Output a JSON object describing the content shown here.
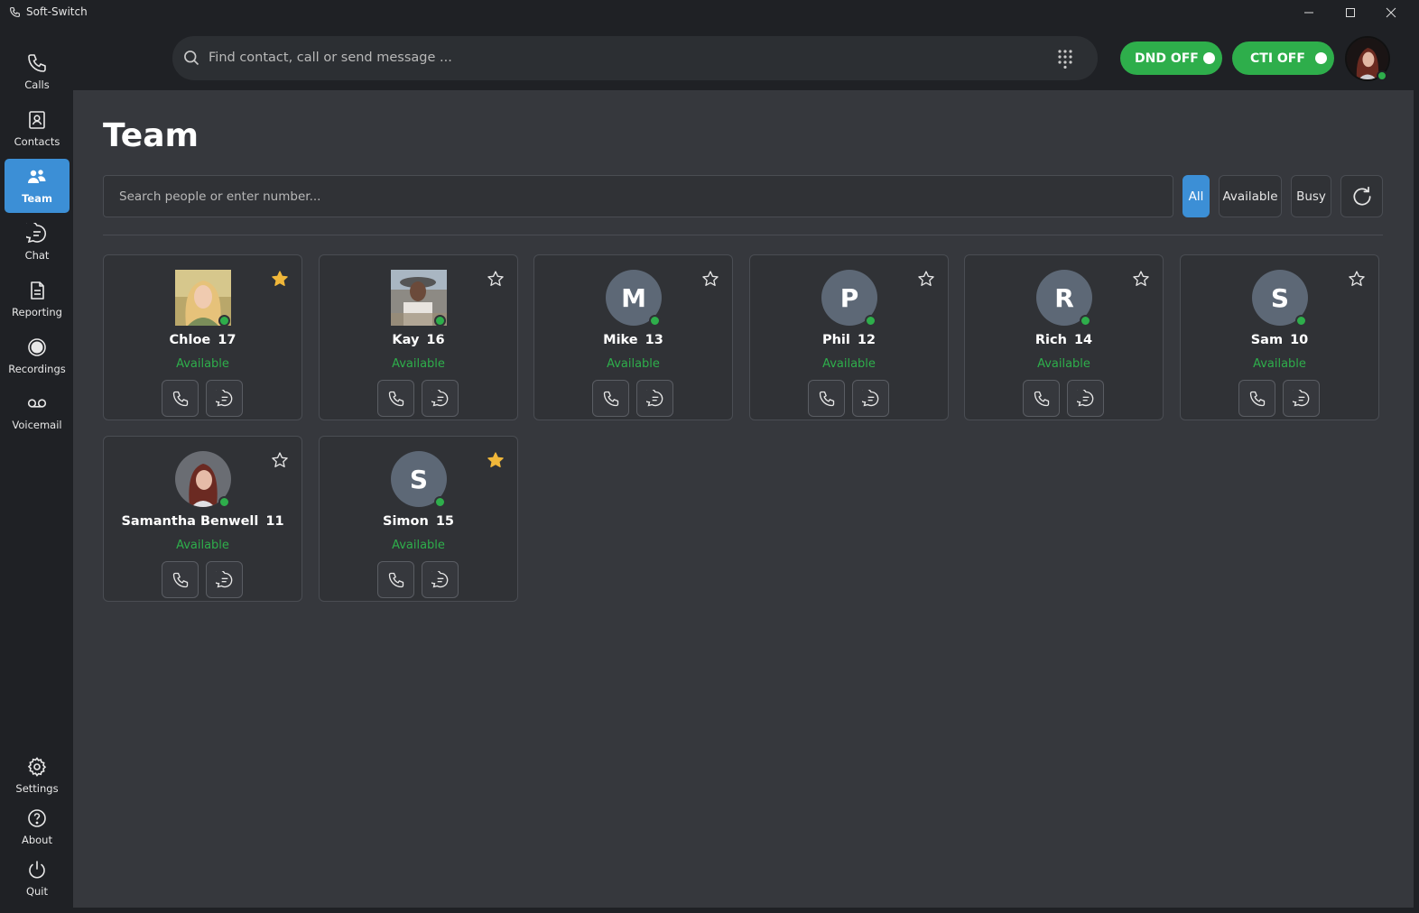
{
  "window": {
    "title": "Soft-Switch"
  },
  "sidebar": {
    "items": [
      {
        "label": "Calls",
        "icon": "phone-icon"
      },
      {
        "label": "Contacts",
        "icon": "contacts-icon"
      },
      {
        "label": "Team",
        "icon": "team-icon",
        "active": true
      },
      {
        "label": "Chat",
        "icon": "chat-icon"
      },
      {
        "label": "Reporting",
        "icon": "reporting-icon"
      },
      {
        "label": "Recordings",
        "icon": "record-icon"
      },
      {
        "label": "Voicemail",
        "icon": "voicemail-icon"
      }
    ],
    "bottom": [
      {
        "label": "Settings",
        "icon": "gear-icon"
      },
      {
        "label": "About",
        "icon": "help-icon"
      },
      {
        "label": "Quit",
        "icon": "power-icon"
      }
    ]
  },
  "header": {
    "search_placeholder": "Find contact, call or send message ...",
    "dnd_label": "DND OFF",
    "cti_label": "CTI OFF"
  },
  "team": {
    "title": "Team",
    "search_placeholder": "Search people or enter number...",
    "filters": [
      "All",
      "Available",
      "Busy"
    ],
    "active_filter": "All",
    "members": [
      {
        "name": "Chloe",
        "ext": "17",
        "status": "Available",
        "favorite": true,
        "avatar": "photo"
      },
      {
        "name": "Kay",
        "ext": "16",
        "status": "Available",
        "favorite": false,
        "avatar": "photo"
      },
      {
        "name": "Mike",
        "ext": "13",
        "status": "Available",
        "favorite": false,
        "avatar": "M"
      },
      {
        "name": "Phil",
        "ext": "12",
        "status": "Available",
        "favorite": false,
        "avatar": "P"
      },
      {
        "name": "Rich",
        "ext": "14",
        "status": "Available",
        "favorite": false,
        "avatar": "R"
      },
      {
        "name": "Sam",
        "ext": "10",
        "status": "Available",
        "favorite": false,
        "avatar": "S"
      },
      {
        "name": "Samantha Benwell",
        "ext": "11",
        "status": "Available",
        "favorite": false,
        "avatar": "photo"
      },
      {
        "name": "Simon",
        "ext": "15",
        "status": "Available",
        "favorite": true,
        "avatar": "S"
      }
    ]
  },
  "colors": {
    "accent": "#3c8fd6",
    "available": "#2eae4b",
    "favorite": "#f0b73a"
  }
}
